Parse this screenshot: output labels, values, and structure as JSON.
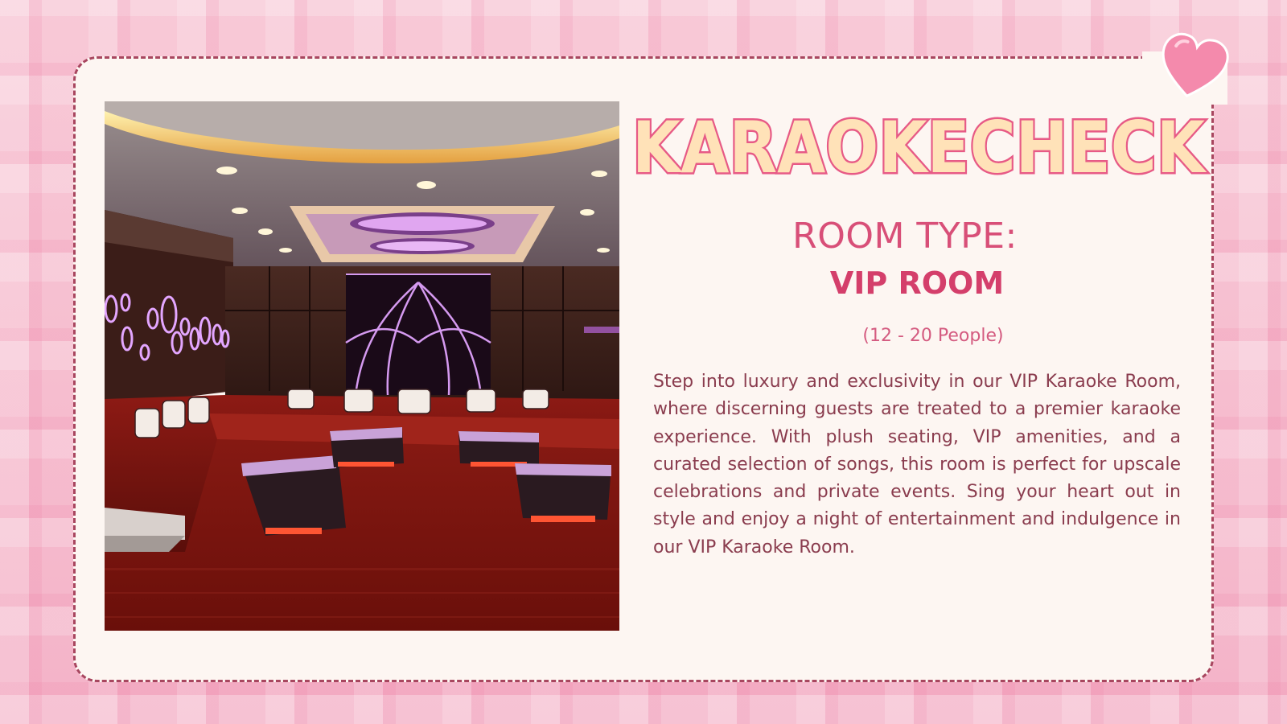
{
  "brand": {
    "title": "KARAOKECHECK"
  },
  "room": {
    "type_label": "ROOM TYPE:",
    "name": "VIP ROOM",
    "capacity": "(12 - 20 People)",
    "description": "Step into luxury and exclusivity in our VIP Karaoke Room, where discerning guests are treated to a premier karaoke experience. With plush seating, VIP amenities, and a curated selection of songs, this room is perfect for upscale celebrations and private events. Sing your heart out in style and enjoy a night of entertainment and indulgence in our VIP Karaoke Room."
  },
  "decor": {
    "corner_icon": "heart-icon",
    "photo": "vip-karaoke-room-photo"
  },
  "colors": {
    "background": "#f7c3d3",
    "card": "#fdf6f2",
    "border": "#a8465f",
    "accent": "#d84f78",
    "title_fill": "#ffe2b8",
    "title_stroke": "#e75a86",
    "body_text": "#8a3c4e"
  }
}
